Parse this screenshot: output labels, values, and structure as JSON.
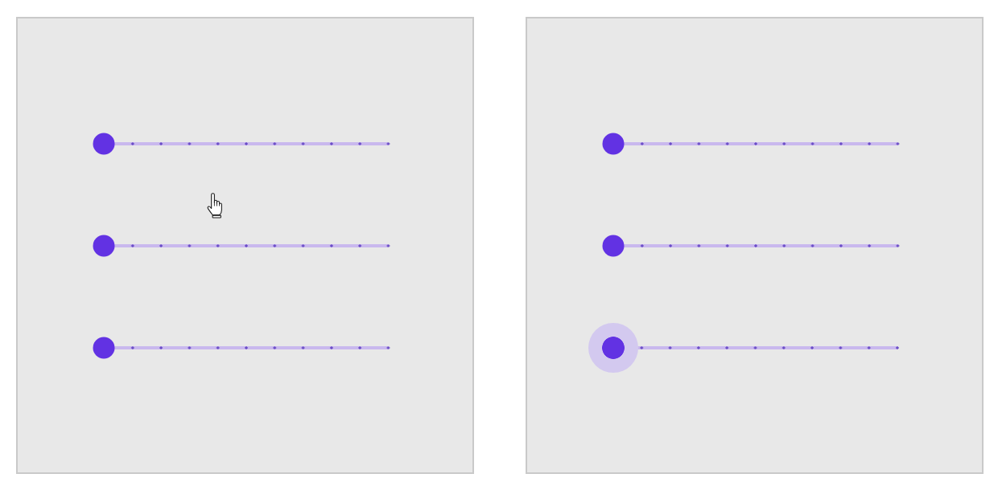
{
  "panels": [
    {
      "cursor_shown": true,
      "sliders": [
        {
          "level": 0,
          "focused": false
        },
        {
          "level": 0,
          "focused": false
        },
        {
          "level": 0,
          "focused": false
        }
      ]
    },
    {
      "cursor_shown": false,
      "sliders": [
        {
          "level": 0,
          "focused": false
        },
        {
          "level": 0,
          "focused": false
        },
        {
          "level": 0,
          "focused": true
        }
      ]
    }
  ]
}
